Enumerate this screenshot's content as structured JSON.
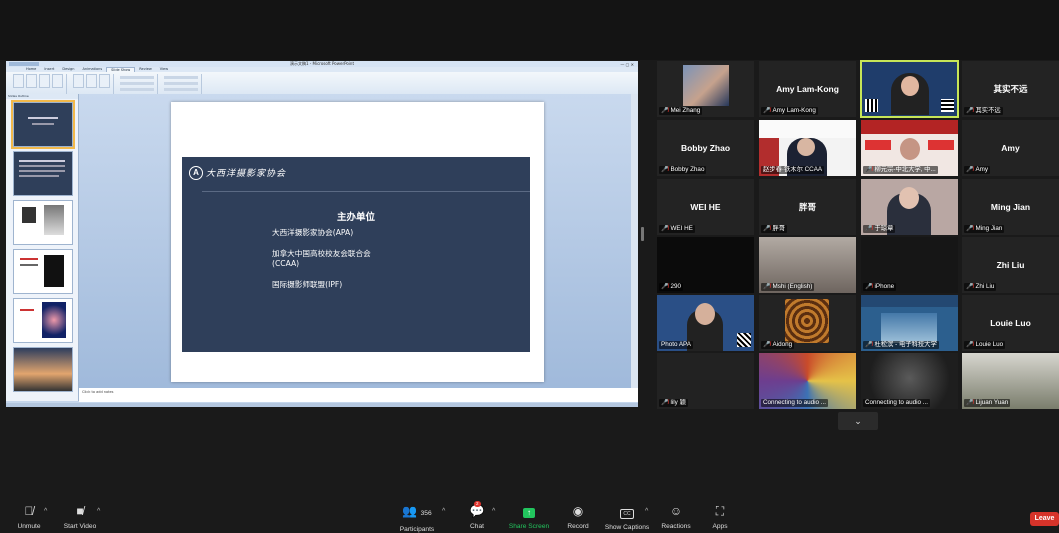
{
  "ppt": {
    "title": "演示文稿1 - Microsoft PowerPoint",
    "tabs": [
      "Home",
      "Insert",
      "Design",
      "Animations",
      "Slide Show",
      "Review",
      "View"
    ],
    "pane_tabs": "Slides  Outline",
    "notes_placeholder": "Click to add notes",
    "slide": {
      "logo_text": "大西洋摄影家协会",
      "heading": "主办单位",
      "items": [
        "大西洋摄影家协会(APA)",
        "加拿大中国高校校友会联合会",
        "(CCAA)",
        "国际摄影师联盟(IPF)"
      ]
    }
  },
  "gallery": [
    {
      "label": "Mei Zhang",
      "big": "",
      "muted": true
    },
    {
      "label": "Amy Lam-Kong",
      "big": "Amy Lam-Kong",
      "muted": true
    },
    {
      "label": "",
      "big": "",
      "muted": false
    },
    {
      "label": "其实不远",
      "big": "其实不远",
      "muted": true
    },
    {
      "label": "Bobby Zhao",
      "big": "Bobby Zhao",
      "muted": true
    },
    {
      "label": "赵步春·铁木尔 CCAA",
      "big": "",
      "muted": false
    },
    {
      "label": "柳元宗-中北大学, 中...",
      "big": "",
      "muted": true
    },
    {
      "label": "Amy",
      "big": "Amy",
      "muted": true
    },
    {
      "label": "WEI HE",
      "big": "WEI HE",
      "muted": true
    },
    {
      "label": "胖哥",
      "big": "胖哥",
      "muted": true
    },
    {
      "label": "于琼章",
      "big": "",
      "muted": true
    },
    {
      "label": "Ming Jian",
      "big": "Ming Jian",
      "muted": true
    },
    {
      "label": "290",
      "big": "",
      "muted": true
    },
    {
      "label": "Mshi (English)",
      "big": "",
      "muted": true
    },
    {
      "label": "iPhone",
      "big": "",
      "muted": true
    },
    {
      "label": "Zhi Liu",
      "big": "Zhi Liu",
      "muted": true
    },
    {
      "label": "Photo APA",
      "big": "",
      "muted": false
    },
    {
      "label": "Aidong",
      "big": "",
      "muted": true
    },
    {
      "label": "杜松滨 - 电子科技大学",
      "big": "",
      "muted": true
    },
    {
      "label": "Louie Luo",
      "big": "Louie Luo",
      "muted": true
    },
    {
      "label": "lily 颖",
      "big": "",
      "muted": true
    },
    {
      "label": "Connecting to audio ...",
      "big": "",
      "muted": false
    },
    {
      "label": "Connecting to audio ...",
      "big": "",
      "muted": false
    },
    {
      "label": "Lijuan Yuan",
      "big": "",
      "muted": true
    }
  ],
  "toolbar": {
    "unmute": "Unmute",
    "start_video": "Start Video",
    "participants": "Participants",
    "participant_count": "356",
    "chat": "Chat",
    "chat_badge": "2",
    "share_screen": "Share Screen",
    "record": "Record",
    "captions": "Show Captions",
    "reactions": "Reactions",
    "apps": "Apps",
    "leave": "Leave"
  },
  "colors": {
    "accent_green": "#22c55e",
    "leave_red": "#d6332a",
    "speaker_outline": "#c7e657"
  }
}
